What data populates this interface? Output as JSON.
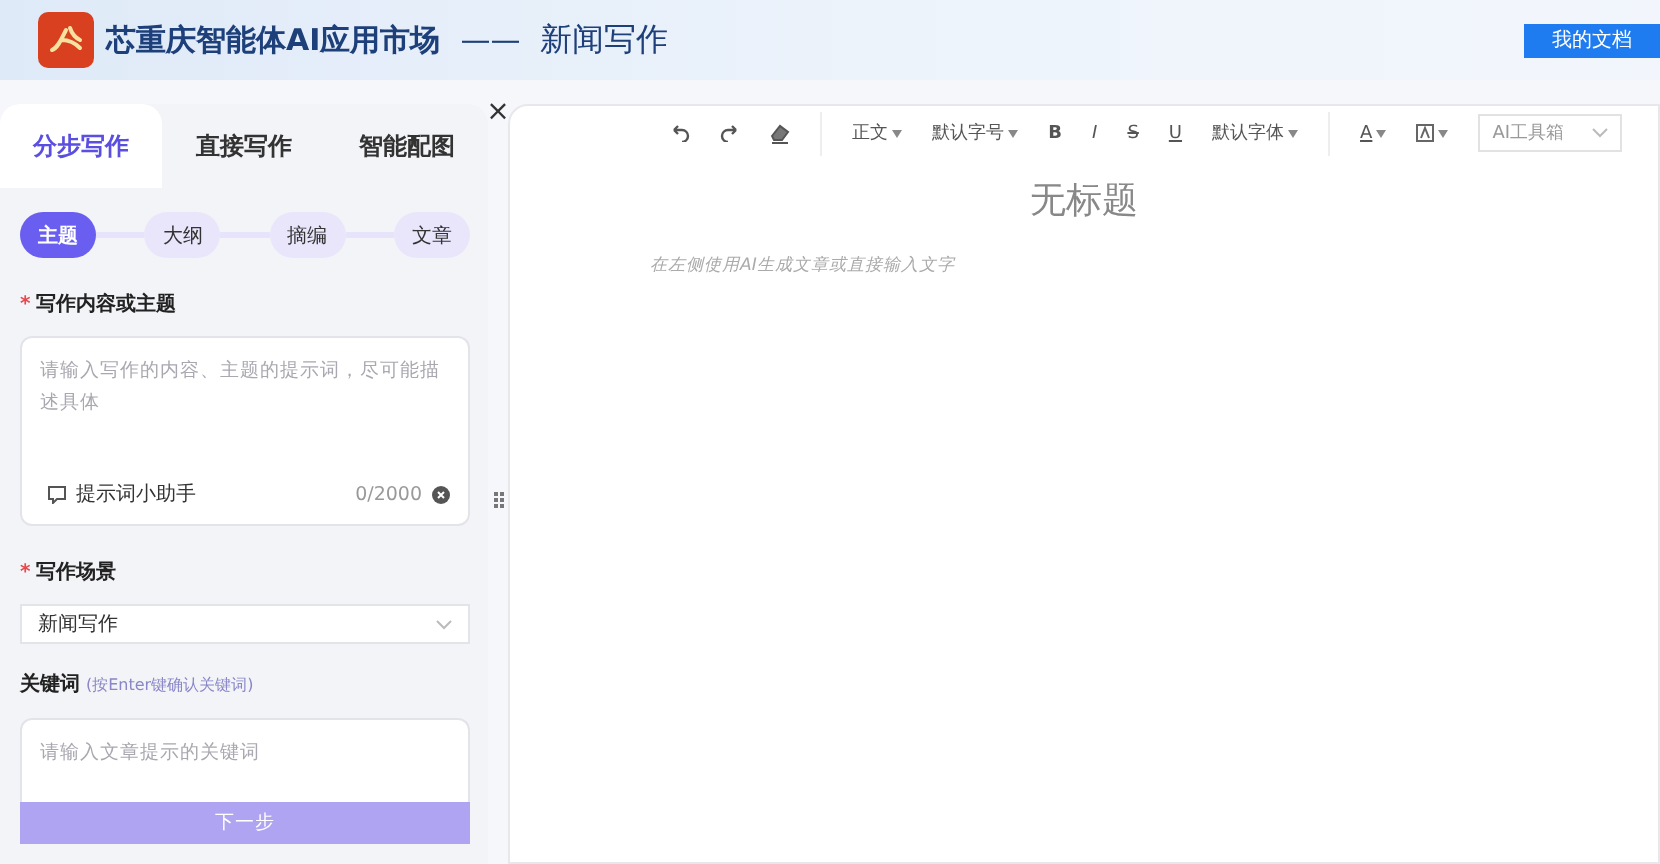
{
  "header": {
    "brand": "芯重庆智能体AI应用市场",
    "separator": "——",
    "page_title": "新闻写作",
    "docs_button": "我的文档"
  },
  "left_panel": {
    "tabs": [
      {
        "label": "分步写作",
        "selected": true
      },
      {
        "label": "直接写作",
        "selected": false
      },
      {
        "label": "智能配图",
        "selected": false
      }
    ],
    "steps": [
      {
        "label": "主题",
        "selected": true
      },
      {
        "label": "大纲",
        "selected": false
      },
      {
        "label": "摘编",
        "selected": false
      },
      {
        "label": "文章",
        "selected": false
      }
    ],
    "topic": {
      "label": "写作内容或主题",
      "required_mark": "*",
      "placeholder": "请输入写作的内容、主题的提示词，尽可能描述具体",
      "helper": "提示词小助手",
      "counter": "0/2000"
    },
    "scene": {
      "label": "写作场景",
      "required_mark": "*",
      "value": "新闻写作"
    },
    "keywords": {
      "label": "关键词",
      "hint": "(按Enter键确认关键词)",
      "placeholder": "请输入文章提示的关键词"
    },
    "next_button": "下一步"
  },
  "close": "×",
  "editor": {
    "toolbar": [
      {
        "kind": "undo"
      },
      {
        "kind": "redo"
      },
      {
        "kind": "eraser"
      },
      {
        "kind": "divider"
      },
      {
        "kind": "dropdown",
        "label": "正文"
      },
      {
        "kind": "dropdown",
        "label": "默认字号"
      },
      {
        "kind": "bold",
        "label": "B"
      },
      {
        "kind": "italic",
        "label": "I"
      },
      {
        "kind": "strike",
        "label": "S"
      },
      {
        "kind": "underline",
        "label": "U"
      },
      {
        "kind": "dropdown",
        "label": "默认字体"
      },
      {
        "kind": "divider"
      },
      {
        "kind": "color",
        "label": "A"
      },
      {
        "kind": "highlight"
      },
      {
        "kind": "select",
        "label": "AI工具箱"
      }
    ],
    "title": "无标题",
    "placeholder": "在左侧使用AI生成文章或直接输入文字"
  }
}
